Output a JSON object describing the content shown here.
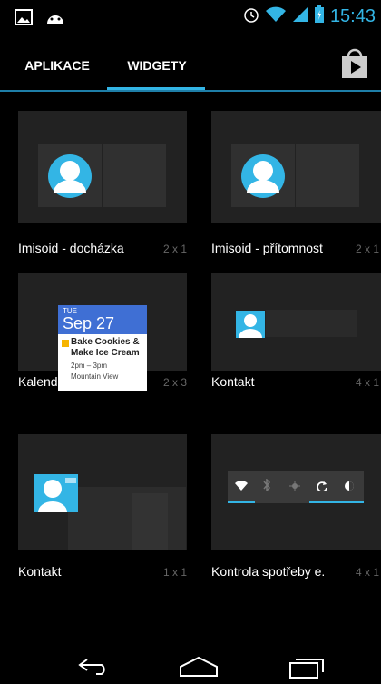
{
  "status_bar": {
    "time": "15:43",
    "icons": [
      "gallery-icon",
      "android-icon",
      "alarm-icon",
      "wifi-icon",
      "signal-icon",
      "battery-charging-icon"
    ]
  },
  "tabs": [
    {
      "label": "APLIKACE",
      "selected": false
    },
    {
      "label": "WIDGETY",
      "selected": true
    }
  ],
  "accent_color": "#33b5e5",
  "widgets": [
    {
      "name": "Imisoid - docházka",
      "size": "2 x 1"
    },
    {
      "name": "Imisoid - přítomnost",
      "size": "2 x 1"
    },
    {
      "name": "Kalendář",
      "size": "2 x 3",
      "preview": {
        "day": "TUE",
        "date": "Sep 27",
        "event": "Bake Cookies & Make Ice Cream",
        "time": "2pm – 3pm",
        "location": "Mountain View"
      }
    },
    {
      "name": "Kontakt",
      "size": "4 x 1"
    },
    {
      "name": "Kontakt",
      "size": "1 x 1"
    },
    {
      "name": "Kontrola spotřeby e.",
      "size": "4 x 1"
    }
  ],
  "nav": [
    "back-icon",
    "home-icon",
    "recents-icon"
  ]
}
